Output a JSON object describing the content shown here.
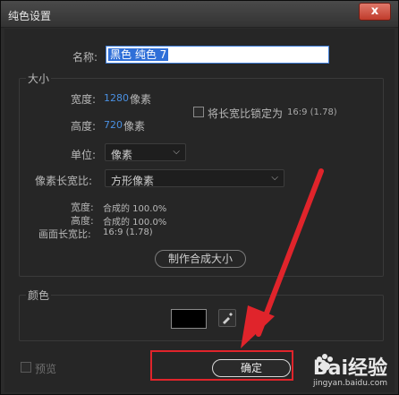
{
  "window": {
    "title": "纯色设置",
    "close_label": "x"
  },
  "name": {
    "label": "名称:",
    "value": "黑色 纯色 7"
  },
  "size_group": {
    "title": "大小",
    "width_label": "宽度:",
    "width_value": "1280",
    "width_unit": "像素",
    "height_label": "高度:",
    "height_value": "720",
    "height_unit": "像素",
    "lock_label": "将长宽比锁定为",
    "lock_ratio": "16:9 (1.78)",
    "unit_label": "单位:",
    "unit_value": "像素",
    "pixel_aspect_label": "像素长宽比:",
    "pixel_aspect_value": "方形像素",
    "info_width_label": "宽度:",
    "info_width_value": "合成的 100.0%",
    "info_height_label": "高度:",
    "info_height_value": "合成的 100.0%",
    "info_frame_label": "画面长宽比:",
    "info_frame_value": "16:9 (1.78)",
    "make_comp_size_label": "制作合成大小"
  },
  "color_group": {
    "title": "颜色",
    "swatch_color": "#000000"
  },
  "footer": {
    "preview_label": "预览",
    "ok_label": "确定"
  },
  "watermark": {
    "brand": "Bai经验",
    "url": "jingyan.baidu.com"
  },
  "colors": {
    "accent": "#4a90e2",
    "highlight": "#e0242b"
  }
}
